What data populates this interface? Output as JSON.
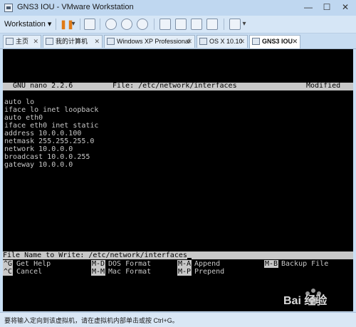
{
  "window": {
    "title": "GNS3 IOU - VMware Workstation",
    "controls": {
      "minimize": "—",
      "maximize": "☐",
      "close": "✕"
    }
  },
  "toolbar": {
    "menu_label": "Workstation ▾",
    "pause_glyph": "❚❚",
    "dropdown_glyph": "▾"
  },
  "tabs": [
    {
      "label": "主页",
      "active": false
    },
    {
      "label": "我的计算机",
      "active": false
    },
    {
      "label": "Windows XP Professional",
      "active": false
    },
    {
      "label": "OS X 10.10",
      "active": false
    },
    {
      "label": "GNS3 IOU",
      "active": true
    }
  ],
  "nano": {
    "version": "GNU nano 2.2.6",
    "file": "File: /etc/network/interfaces",
    "status": "Modified",
    "lines": [
      "auto lo",
      "iface lo inet loopback",
      "auto eth0",
      "iface eth0 inet static",
      "address 10.0.0.100",
      "netmask 255.255.255.0",
      "network 10.0.0.0",
      "broadcast 10.0.0.255",
      "gateway 10.0.0.0"
    ],
    "prompt": "File Name to Write: /etc/network/interfaces",
    "shortcuts": [
      {
        "key": "^G",
        "label": "Get Help"
      },
      {
        "key": "M-D",
        "label": "DOS Format"
      },
      {
        "key": "M-A",
        "label": "Append"
      },
      {
        "key": "M-B",
        "label": "Backup File"
      },
      {
        "key": "^C",
        "label": "Cancel"
      },
      {
        "key": "M-M",
        "label": "Mac Format"
      },
      {
        "key": "M-P",
        "label": "Prepend"
      }
    ]
  },
  "status_bar": {
    "text": "要将输入定向到该虚拟机，请在虚拟机内部单击或按 Ctrl+G。"
  },
  "watermark": {
    "text": "Bai 经验"
  }
}
